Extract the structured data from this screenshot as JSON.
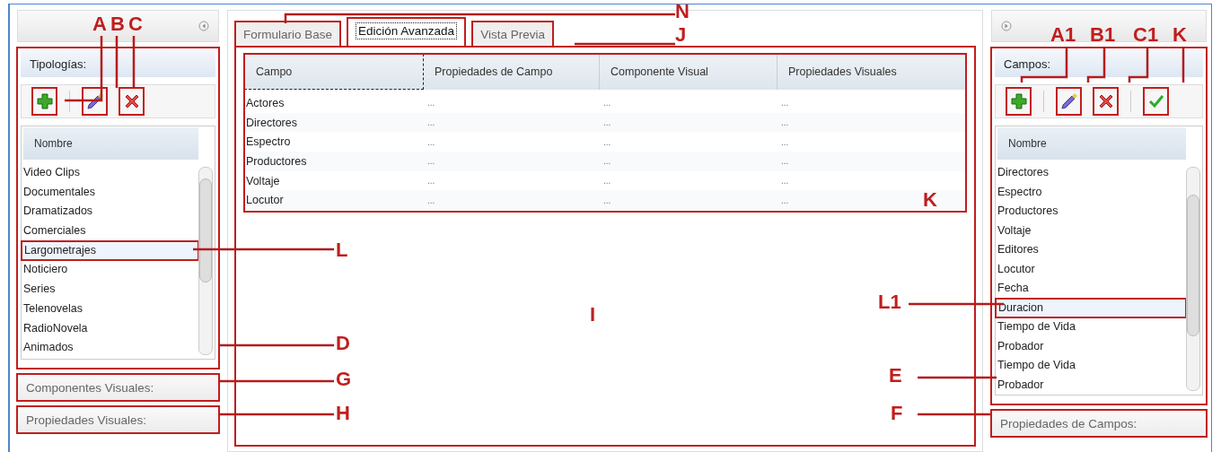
{
  "left_panel": {
    "title": "Tipologías:",
    "toolbar": [
      {
        "kind": "add"
      },
      {
        "kind": "edit"
      },
      {
        "kind": "delete"
      }
    ],
    "list_header": "Nombre",
    "items": [
      {
        "label": "Video Clips",
        "selected": false
      },
      {
        "label": "Documentales",
        "selected": false
      },
      {
        "label": "Dramatizados",
        "selected": false
      },
      {
        "label": "Comerciales",
        "selected": false
      },
      {
        "label": "Largometrajes",
        "selected": true
      },
      {
        "label": "Noticiero",
        "selected": false
      },
      {
        "label": "Series",
        "selected": false
      },
      {
        "label": "Telenovelas",
        "selected": false
      },
      {
        "label": "RadioNovela",
        "selected": false
      },
      {
        "label": "Animados",
        "selected": false
      }
    ],
    "sections": [
      "Componentes Visuales:",
      "Propiedades Visuales:"
    ]
  },
  "tabs": [
    {
      "label": "Formulario Base",
      "selected": false
    },
    {
      "label": "Edición Avanzada",
      "selected": true
    },
    {
      "label": "Vista Previa",
      "selected": false
    }
  ],
  "table": {
    "columns": [
      "Campo",
      "Propiedades de Campo",
      "Componente Visual",
      "Propiedades Visuales"
    ],
    "rows": [
      {
        "campo": "Actores",
        "cells": [
          "...",
          "...",
          "..."
        ]
      },
      {
        "campo": "Directores",
        "cells": [
          "...",
          "...",
          "..."
        ]
      },
      {
        "campo": "Espectro",
        "cells": [
          "...",
          "...",
          "..."
        ]
      },
      {
        "campo": "Productores",
        "cells": [
          "...",
          "...",
          "..."
        ]
      },
      {
        "campo": "Voltaje",
        "cells": [
          "...",
          "...",
          "..."
        ]
      },
      {
        "campo": "Locutor",
        "cells": [
          "...",
          "...",
          "..."
        ]
      }
    ]
  },
  "right_panel": {
    "title": "Campos:",
    "toolbar": [
      {
        "kind": "add"
      },
      {
        "kind": "edit"
      },
      {
        "kind": "delete"
      },
      {
        "kind": "accept"
      }
    ],
    "list_header": "Nombre",
    "items": [
      {
        "label": "Directores",
        "selected": false
      },
      {
        "label": "Espectro",
        "selected": false
      },
      {
        "label": "Productores",
        "selected": false
      },
      {
        "label": "Voltaje",
        "selected": false
      },
      {
        "label": "Editores",
        "selected": false
      },
      {
        "label": "Locutor",
        "selected": false
      },
      {
        "label": "Fecha",
        "selected": false
      },
      {
        "label": "Duracion",
        "selected": true
      },
      {
        "label": "Tiempo de Vida",
        "selected": false
      },
      {
        "label": "Probador",
        "selected": false
      },
      {
        "label": "Tiempo de Vida",
        "selected": false
      },
      {
        "label": "Probador",
        "selected": false
      }
    ],
    "sections": [
      "Propiedades de Campos:"
    ]
  },
  "callouts": [
    "A",
    "B",
    "C",
    "N",
    "J",
    "K",
    "L",
    "I",
    "D",
    "G",
    "H",
    "L1",
    "E",
    "F",
    "A1",
    "B1",
    "C1",
    "K"
  ]
}
